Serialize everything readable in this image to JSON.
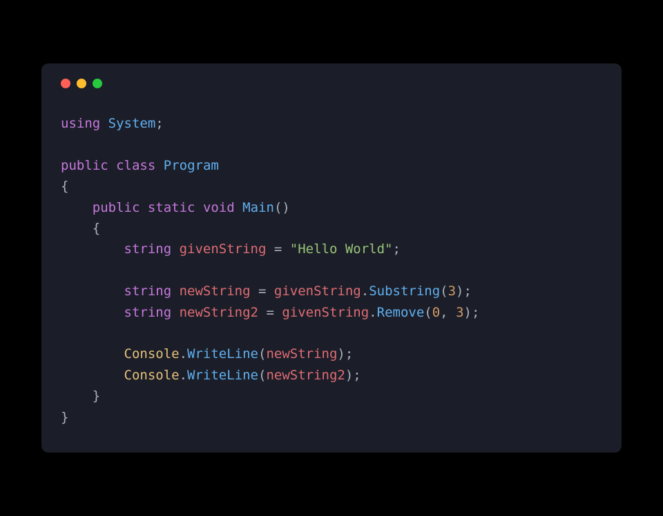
{
  "window": {
    "buttons": {
      "close": "close",
      "minimize": "minimize",
      "maximize": "maximize"
    }
  },
  "code": {
    "language": "csharp",
    "l1": {
      "using": "using",
      "system": "System",
      "semi": ";"
    },
    "l3": {
      "public": "public",
      "class": "class",
      "program": "Program"
    },
    "l4": {
      "brace": "{"
    },
    "l5": {
      "public": "public",
      "static": "static",
      "void": "void",
      "main": "Main",
      "parens": "()"
    },
    "l6": {
      "brace": "{"
    },
    "l7": {
      "type": "string",
      "name": "givenString",
      "eq": " = ",
      "str": "\"Hello World\"",
      "semi": ";"
    },
    "l9": {
      "type": "string",
      "name": "newString",
      "eq": " = ",
      "obj": "givenString",
      "dot": ".",
      "method": "Substring",
      "open": "(",
      "arg": "3",
      "close": ");"
    },
    "l10": {
      "type": "string",
      "name": "newString2",
      "eq": " = ",
      "obj": "givenString",
      "dot": ".",
      "method": "Remove",
      "open": "(",
      "arg1": "0",
      "comma": ", ",
      "arg2": "3",
      "close": ");"
    },
    "l12": {
      "obj": "Console",
      "dot": ".",
      "method": "WriteLine",
      "open": "(",
      "arg": "newString",
      "close": ");"
    },
    "l13": {
      "obj": "Console",
      "dot": ".",
      "method": "WriteLine",
      "open": "(",
      "arg": "newString2",
      "close": ");"
    },
    "l14": {
      "brace": "}"
    },
    "l15": {
      "brace": "}"
    }
  }
}
